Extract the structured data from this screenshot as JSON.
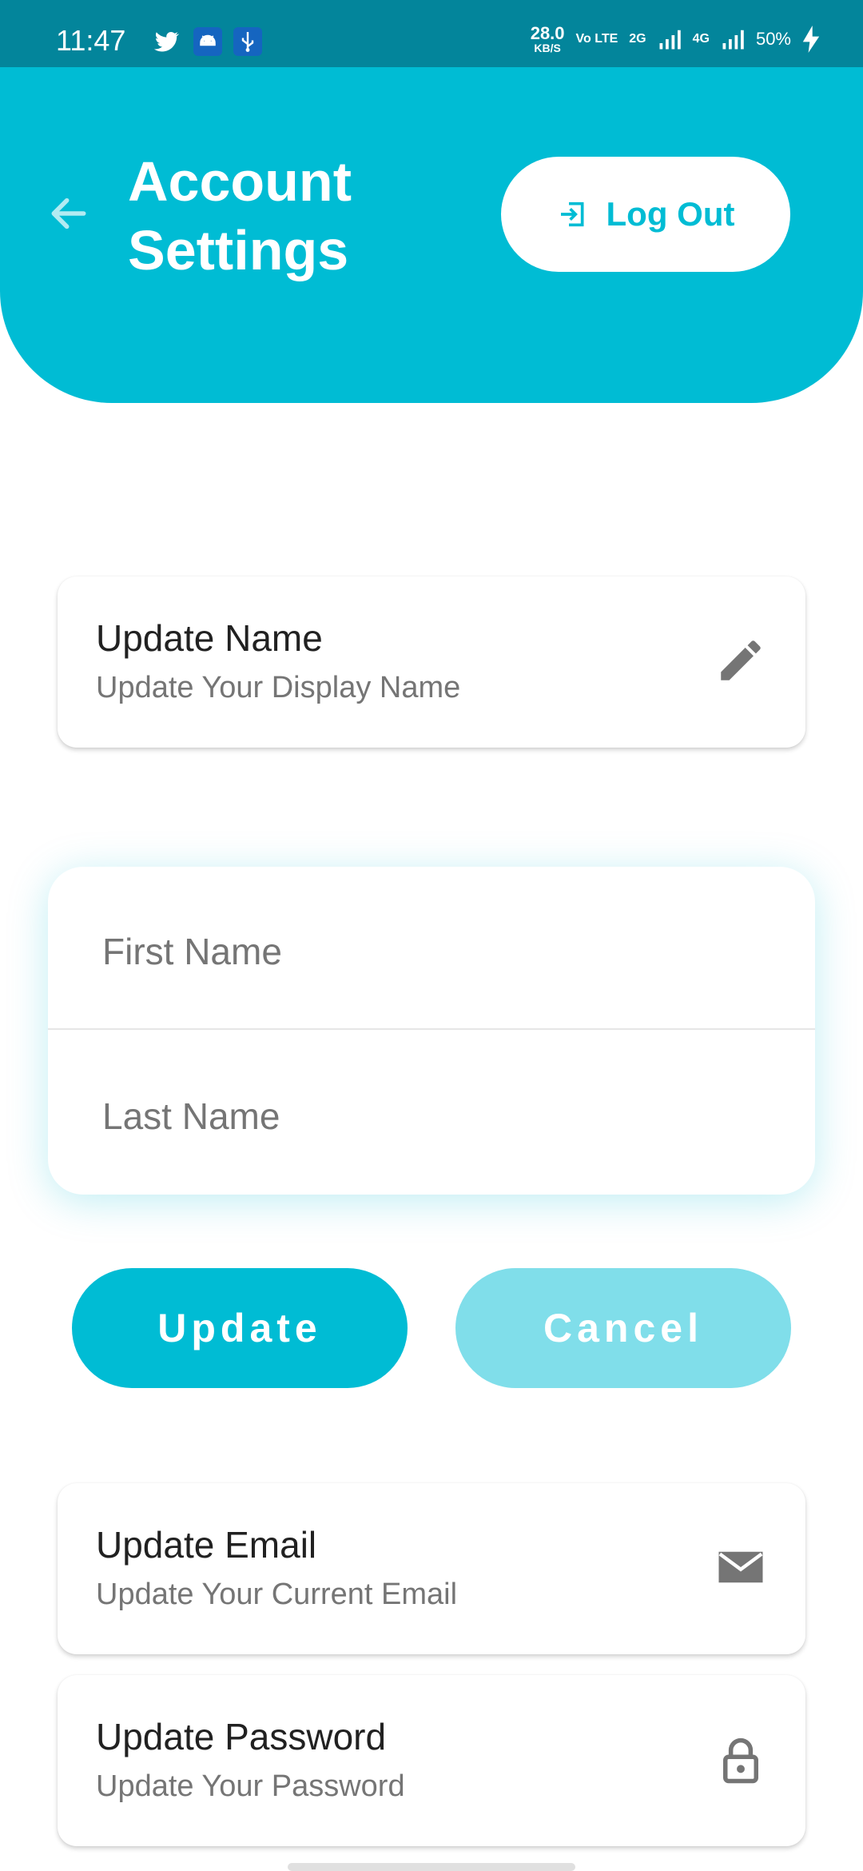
{
  "status_bar": {
    "time": "11:47",
    "speed_value": "28.0",
    "speed_unit": "KB/S",
    "volte": "Vo LTE",
    "net_2g": "2G",
    "net_4g": "4G",
    "battery": "50%"
  },
  "header": {
    "title": "Account Settings",
    "logout_label": "Log Out"
  },
  "cards": {
    "name": {
      "title": "Update Name",
      "subtitle": "Update Your Display Name",
      "icon": "pencil-icon"
    },
    "email": {
      "title": "Update Email",
      "subtitle": "Update Your Current Email",
      "icon": "mail-icon"
    },
    "password": {
      "title": "Update Password",
      "subtitle": "Update Your Password",
      "icon": "lock-icon"
    }
  },
  "form": {
    "first_name_placeholder": "First Name",
    "last_name_placeholder": "Last Name",
    "first_name_value": "",
    "last_name_value": ""
  },
  "buttons": {
    "update": "Update",
    "cancel": "Cancel"
  },
  "colors": {
    "primary": "#00bcd4",
    "primary_light": "#80deea",
    "status_bar": "#03859b"
  }
}
